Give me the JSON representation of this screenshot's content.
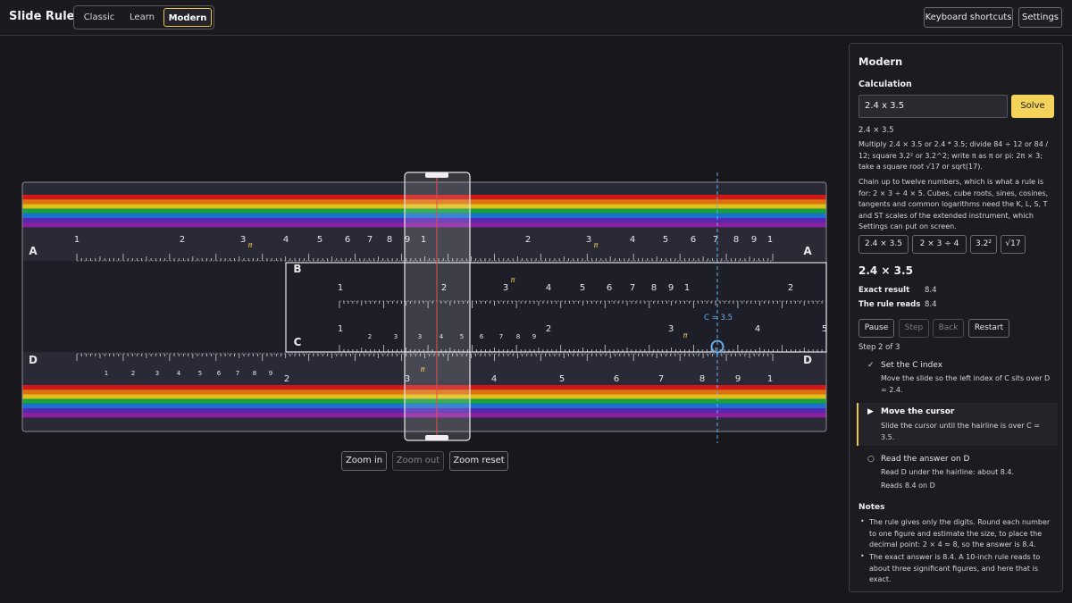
{
  "app": {
    "title": "Slide Rule",
    "modes": [
      "Classic",
      "Learn",
      "Modern"
    ],
    "active_mode": "Modern",
    "keyboard_shortcuts_label": "Keyboard shortcuts",
    "settings_label": "Settings"
  },
  "rule": {
    "scale_labels": [
      "A",
      "B",
      "C",
      "D"
    ],
    "a_ticks": [
      "1",
      "2",
      "3",
      "4",
      "5",
      "6",
      "7",
      "8",
      "9",
      "1",
      "2",
      "3",
      "4",
      "5",
      "6",
      "7",
      "8",
      "9",
      "1"
    ],
    "b_ticks": [
      "1",
      "2",
      "3",
      "4",
      "5",
      "6",
      "7",
      "8",
      "9",
      "1",
      "2"
    ],
    "c_ticks": [
      "1",
      "2",
      "3",
      "4",
      "5",
      "6",
      "7",
      "8",
      "9",
      "2",
      "3",
      "4",
      "5"
    ],
    "d_ticks": [
      "1",
      "2",
      "3",
      "4",
      "5",
      "6",
      "7",
      "8",
      "9",
      "2",
      "3",
      "4",
      "5",
      "6",
      "7",
      "8",
      "9",
      "1"
    ],
    "pi_symbol": "π",
    "marker_label": "C = 3.5",
    "zoom_in": "Zoom in",
    "zoom_out": "Zoom out",
    "zoom_reset": "Zoom reset",
    "colors": {
      "accent": "#f3d35a",
      "marker": "#6aaee6",
      "hairline": "#e05050"
    }
  },
  "panel": {
    "title": "Modern",
    "calc_label": "Calculation",
    "input_value": "2.4 x 3.5",
    "solve_label": "Solve",
    "parsed": "2.4 × 3.5",
    "help1": "Multiply 2.4 × 3.5 or 2.4 * 3.5; divide 84 ÷ 12 or 84 / 12; square 3.2² or 3.2^2; write π as π or pi: 2π × 3; take a square root √17 or sqrt(17).",
    "help2": "Chain up to twelve numbers, which is what a rule is for: 2 × 3 ÷ 4 × 5. Cubes, cube roots, sines, cosines, tangents and common logarithms need the K, L, S, T and ST scales of the extended instrument, which Settings can put on screen.",
    "examples": [
      "2.4 × 3.5",
      "2 × 3 ÷ 4",
      "3.2²",
      "√17"
    ],
    "result_title": "2.4 × 3.5",
    "exact_label": "Exact result",
    "exact_value": "8.4",
    "reads_label": "The rule reads",
    "reads_value": "8.4",
    "controls": [
      "Pause",
      "Step",
      "Back",
      "Restart"
    ],
    "step_counter": "Step 2 of 3",
    "steps": [
      {
        "icon": "✓",
        "title": "Set the C index",
        "desc": "Move the slide so the left index of C sits over D = 2.4."
      },
      {
        "icon": "▶",
        "title": "Move the cursor",
        "desc": "Slide the cursor until the hairline is over C = 3.5."
      },
      {
        "icon": "○",
        "title": "Read the answer on D",
        "desc": "Read D under the hairline: about 8.4.",
        "extra": "Reads 8.4 on D"
      }
    ],
    "notes_title": "Notes",
    "notes": [
      "The rule gives only the digits. Round each number to one figure and estimate the size, to place the decimal point: 2 × 4 ≈ 8, so the answer is 8.4.",
      "The exact answer is 8.4. A 10-inch rule reads to about three significant figures, and here that is exact."
    ]
  }
}
